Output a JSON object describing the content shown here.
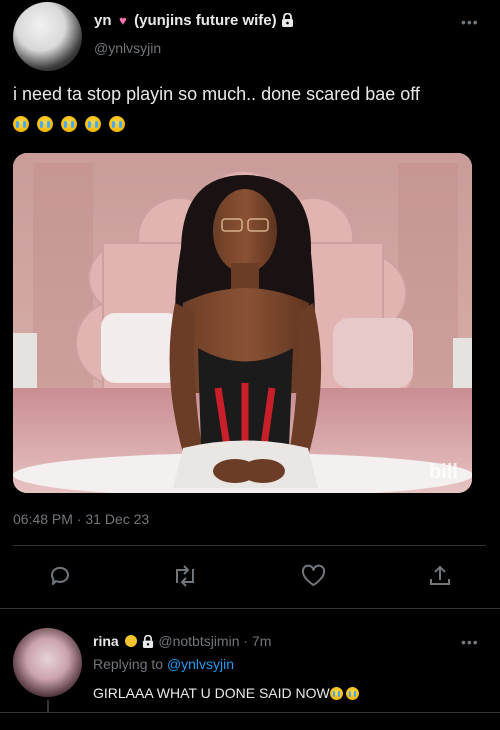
{
  "tweet": {
    "display_name": "yn",
    "display_name_suffix": "(yunjins future wife)",
    "handle": "@ynlvsyjin",
    "text": "i need ta stop playin so much.. done scared bae off",
    "emoji_icons": [
      "loudly-crying-face-icon",
      "loudly-crying-face-icon",
      "loudly-crying-face-icon",
      "loudly-crying-face-icon",
      "loudly-crying-face-icon"
    ],
    "media_watermark": "bill",
    "timestamp": "06:48 PM · 31 Dec 23"
  },
  "actions": [
    "reply-icon",
    "retweet-icon",
    "like-icon",
    "share-icon"
  ],
  "reply": {
    "display_name": "rina",
    "handle_time": "@notbtsjimin · 7m",
    "replying_prefix": "Replying to",
    "replying_handle": "@ynlvsyjin",
    "text": "GIRLAAA WHAT U DONE SAID NOW"
  },
  "colors": {
    "background": "#000000",
    "text": "#e7e9ea",
    "muted": "#71767b",
    "link": "#1d9bf0",
    "divider": "#2f3336"
  }
}
